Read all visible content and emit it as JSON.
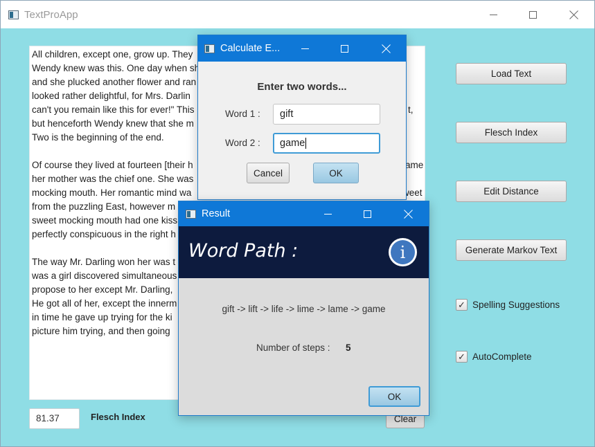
{
  "main_window": {
    "title": "TextProApp",
    "text_paragraphs": [
      [
        "All children, except one, grow up. They",
        "Wendy knew was this. One day when sh",
        "and she plucked another flower and ran",
        "looked rather delightful, for Mrs. Darlin",
        "can't you remain like this for ever!\" This",
        "but henceforth Wendy knew that she m",
        "Two is the beginning of the end."
      ],
      [
        "Of course they lived at fourteen [their h",
        "her mother was the chief one. She was",
        "mocking mouth. Her romantic mind wa",
        "from the puzzling East, however m",
        "sweet mocking mouth had one kiss",
        "perfectly conspicuous in the right h"
      ],
      [
        "The way Mr. Darling won her was t",
        "was a girl discovered simultaneous",
        "propose to her except Mr. Darling,",
        "He got all of her, except the innerm",
        "in time he gave up trying for the ki",
        "picture him trying, and then going"
      ]
    ],
    "right_edge_fragments": {
      "line5": "t,",
      "line9": "ame",
      "line11": "weet",
      "line12": "ome"
    },
    "buttons": {
      "load_text": "Load Text",
      "flesch_index": "Flesch Index",
      "edit_distance": "Edit Distance",
      "generate_markov": "Generate Markov Text",
      "clear": "Clear"
    },
    "checkboxes": {
      "spelling": {
        "label": "Spelling Suggestions",
        "checked": true,
        "mark": "✓"
      },
      "autocomplete": {
        "label": "AutoComplete",
        "checked": true,
        "mark": "✓"
      }
    },
    "flesch_value": "81.37",
    "flesch_label": "Flesch Index"
  },
  "calculate_dialog": {
    "title": "Calculate E...",
    "header": "Enter two words...",
    "word1_label": "Word 1 :",
    "word1_value": "gift",
    "word2_label": "Word 2 :",
    "word2_value": "game",
    "cancel_label": "Cancel",
    "ok_label": "OK"
  },
  "result_dialog": {
    "title": "Result",
    "banner_title": "Word Path :",
    "info_glyph": "i",
    "path": "gift -> lift -> life -> lime -> lame -> game",
    "steps_label": "Number of steps :",
    "steps_value": "5",
    "ok_label": "OK"
  },
  "colors": {
    "window_background": "#8fdde5",
    "titlebar_active": "#0f78d7",
    "banner": "#0d1b3e",
    "info_icon": "#3f77bf"
  }
}
